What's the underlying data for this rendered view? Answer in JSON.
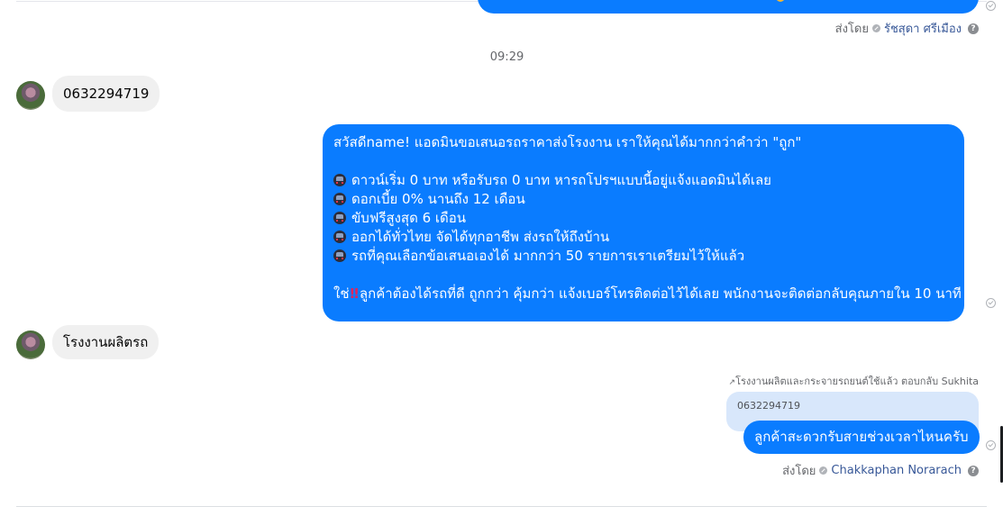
{
  "prev_message": {
    "sent_by_label": "ส่งโดย",
    "sender": "รัชสุดา ศรีเมือง"
  },
  "timestamp": "09:29",
  "incoming_1": {
    "text": "0632294719"
  },
  "outgoing_big": {
    "line1": "สวัสดีname! แอดมินขอเสนอรถราคาส่งโรงงาน เราให้คุณได้มากกว่าคำว่า \"ถูก\"",
    "bullets": [
      "ดาวน์เริ่ม 0 บาท หรือรับรถ 0 บาท หารถโปรฯแบบนี้อยู่แจ้งแอดมินได้เลย",
      "ดอกเบี้ย 0% นานถึง 12 เดือน",
      "ขับฟรีสูงสุด 6 เดือน",
      "ออกได้ทั่วไทย จัดได้ทุกอาชีพ ส่งรถให้ถึงบ้าน",
      "รถที่คุณเลือกข้อเสนอเองได้ มากกว่า 50 รายการเราเตรียมไว้ให้แล้ว"
    ],
    "closing_prefix": "ใช่",
    "closing_text": "ลูกค้าต้องได้รถที่ดี ถูกกว่า คุ้มกว่า แจ้งเบอร์โทรติดต่อไว้ได้เลย พนักงานจะติดต่อกลับคุณภายใน 10 นาที",
    "bullet_icon": "car-icon",
    "emphasis_icon": "double-exclamation-icon"
  },
  "incoming_2": {
    "text": "โรงงานผลิตรถ"
  },
  "reply": {
    "label": "โรงงานผลิตและกระจายรถยนต์ใช้แล้ว ตอบกลับ Sukhita",
    "quoted": "0632294719",
    "text": "ลูกค้าสะดวกรับสายช่วงเวลาไหนครับ",
    "sent_by_label": "ส่งโดย",
    "sender": "Chakkaphan Norarach"
  },
  "colors": {
    "outgoing_bubble": "#0a7cff",
    "incoming_bubble": "#f0f0f0",
    "quote_bubble": "#d8e7fb"
  }
}
